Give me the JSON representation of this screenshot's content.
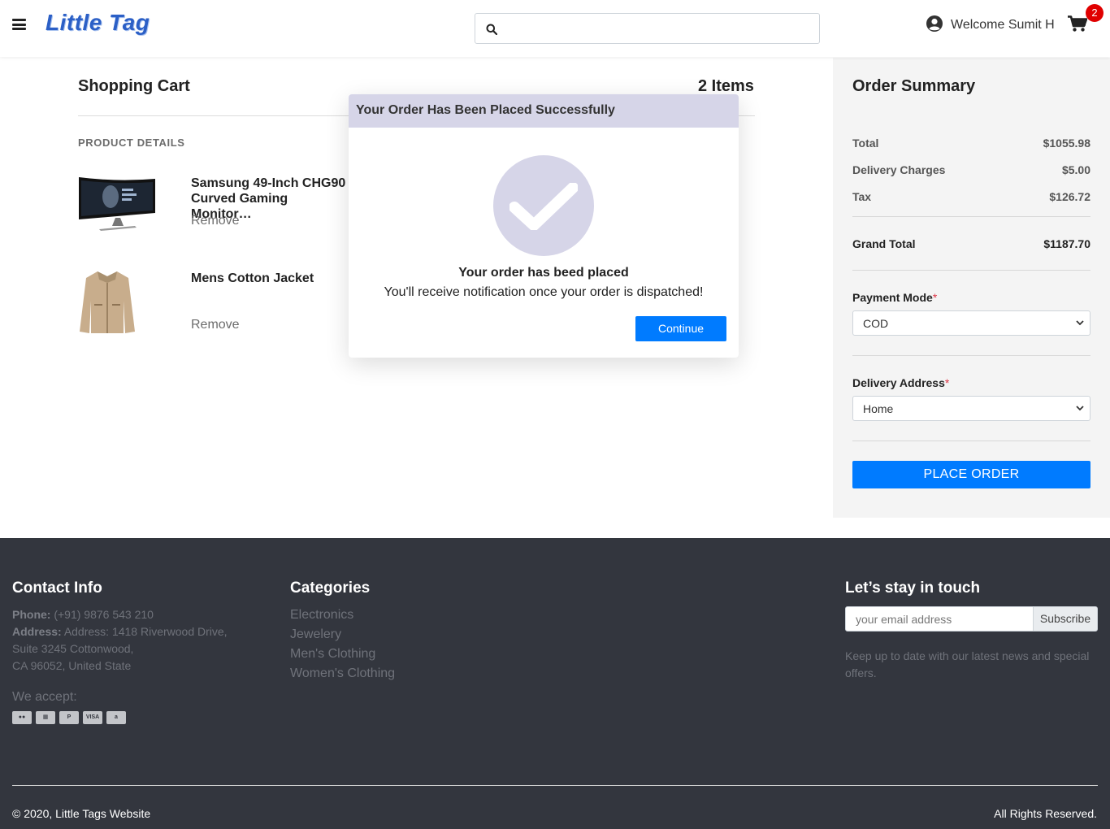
{
  "header": {
    "logo": "Little Tag",
    "search_placeholder": "",
    "welcome": "Welcome Sumit H",
    "cart_count": "2"
  },
  "cart": {
    "title": "Shopping Cart",
    "items_count": "2 Items",
    "column_product": "PRODUCT DETAILS",
    "items": [
      {
        "name": "Samsung 49-Inch CHG90 Curved Gaming Monitor…",
        "remove": "Remove"
      },
      {
        "name": "Mens Cotton Jacket",
        "remove": "Remove"
      }
    ]
  },
  "summary": {
    "title": "Order Summary",
    "total_label": "Total",
    "total_value": "$1055.98",
    "delivery_label": "Delivery Charges",
    "delivery_value": "$5.00",
    "tax_label": "Tax",
    "tax_value": "$126.72",
    "grand_label": "Grand Total",
    "grand_value": "$1187.70",
    "payment_label": "Payment Mode",
    "payment_value": "COD",
    "address_label": "Delivery Address",
    "address_value": "Home",
    "required_mark": "*",
    "place_order": "PLACE ORDER"
  },
  "modal": {
    "title": "Your Order Has Been Placed Successfully",
    "message": "Your order has beed placed",
    "sub_message": "You'll receive notification once your order is dispatched!",
    "continue": "Continue"
  },
  "footer": {
    "contact_title": "Contact Info",
    "phone_label": "Phone:",
    "phone_value": "(+91) 9876 543 210",
    "address_label": "Address:",
    "address_line1": "Address: 1418 Riverwood Drive,",
    "address_line2": "Suite 3245 Cottonwood,",
    "address_line3": "CA 96052, United State",
    "we_accept": "We accept:",
    "categories_title": "Categories",
    "categories": [
      "Electronics",
      "Jewelery",
      "Men's Clothing",
      "Women's Clothing"
    ],
    "newsletter_title": "Let’s stay in touch",
    "email_placeholder": "your email address",
    "subscribe": "Subscribe",
    "newsletter_text": "Keep up to date with our latest news and special offers.",
    "copyright": "© 2020, Little Tags Website",
    "rights": "All Rights Reserved."
  },
  "colors": {
    "primary": "#007bff",
    "modal_header": "#d6d5e8",
    "footer_bg": "#33363e",
    "badge": "#e00000"
  }
}
